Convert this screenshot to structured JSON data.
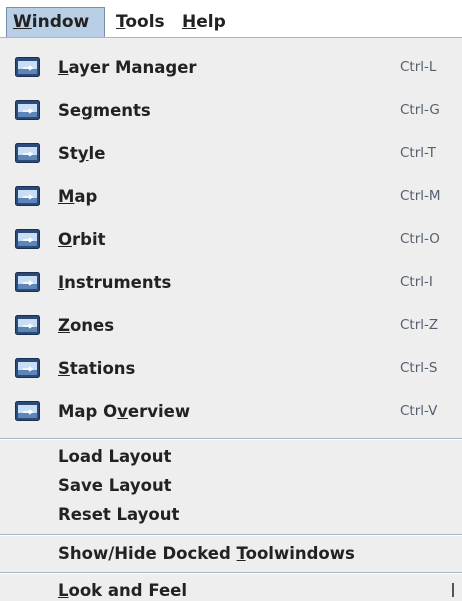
{
  "menubar": {
    "items": [
      {
        "pre": "",
        "mn": "W",
        "post": "indow",
        "active": true
      },
      {
        "pre": "",
        "mn": "T",
        "post": "ools",
        "active": false
      },
      {
        "pre": "",
        "mn": "H",
        "post": "elp",
        "active": false
      }
    ]
  },
  "window_menu": {
    "panels": [
      {
        "pre": "",
        "mn": "L",
        "post": "ayer Manager",
        "accel": "Ctrl-L",
        "icon": "window-icon"
      },
      {
        "pre": "Se",
        "mn": "g",
        "post": "ments",
        "accel": "Ctrl-G",
        "icon": "window-icon"
      },
      {
        "pre": "St",
        "mn": "y",
        "post": "le",
        "accel": "Ctrl-T",
        "icon": "window-icon"
      },
      {
        "pre": "",
        "mn": "M",
        "post": "ap",
        "accel": "Ctrl-M",
        "icon": "window-icon"
      },
      {
        "pre": "",
        "mn": "O",
        "post": "rbit",
        "accel": "Ctrl-O",
        "icon": "window-icon"
      },
      {
        "pre": "",
        "mn": "I",
        "post": "nstruments",
        "accel": "Ctrl-I",
        "icon": "window-icon"
      },
      {
        "pre": "",
        "mn": "Z",
        "post": "ones",
        "accel": "Ctrl-Z",
        "icon": "window-icon"
      },
      {
        "pre": "",
        "mn": "S",
        "post": "tations",
        "accel": "Ctrl-S",
        "icon": "window-icon"
      },
      {
        "pre": "Map O",
        "mn": "v",
        "post": "erview",
        "accel": "Ctrl-V",
        "icon": "window-icon"
      }
    ],
    "layout": {
      "load": "Load Layout",
      "save": "Save Layout",
      "reset": "Reset Layout"
    },
    "toolwindows": {
      "pre": "Show/Hide Docked ",
      "mn": "T",
      "post": "oolwindows"
    },
    "look_and_feel": {
      "pre": "",
      "mn": "L",
      "post": "ook and Feel"
    }
  },
  "colors": {
    "menubar_active_bg": "#b8cfe5",
    "menu_bg": "#eeeeee",
    "separator": "#a6b6c9",
    "accelerator_text": "#555f6e"
  }
}
